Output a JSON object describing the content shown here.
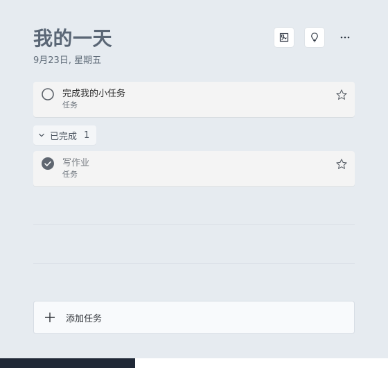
{
  "header": {
    "title": "我的一天",
    "date": "9月23日, 星期五"
  },
  "top_actions": [
    {
      "icon": "background-image-icon"
    },
    {
      "icon": "lightbulb-icon"
    },
    {
      "icon": "more-icon"
    }
  ],
  "tasks": [
    {
      "title": "完成我的小任务",
      "list": "任务",
      "completed": false
    }
  ],
  "completed_section": {
    "label": "已完成",
    "count": "1"
  },
  "completed_tasks": [
    {
      "title": "写作业",
      "list": "任务",
      "completed": true
    }
  ],
  "add_task": {
    "label": "添加任务"
  },
  "colors": {
    "background": "#e6ebf0",
    "title": "#5a6675",
    "card": "#f4f4f4",
    "check_done": "#5f6670",
    "taskbar_left": "#202836"
  }
}
